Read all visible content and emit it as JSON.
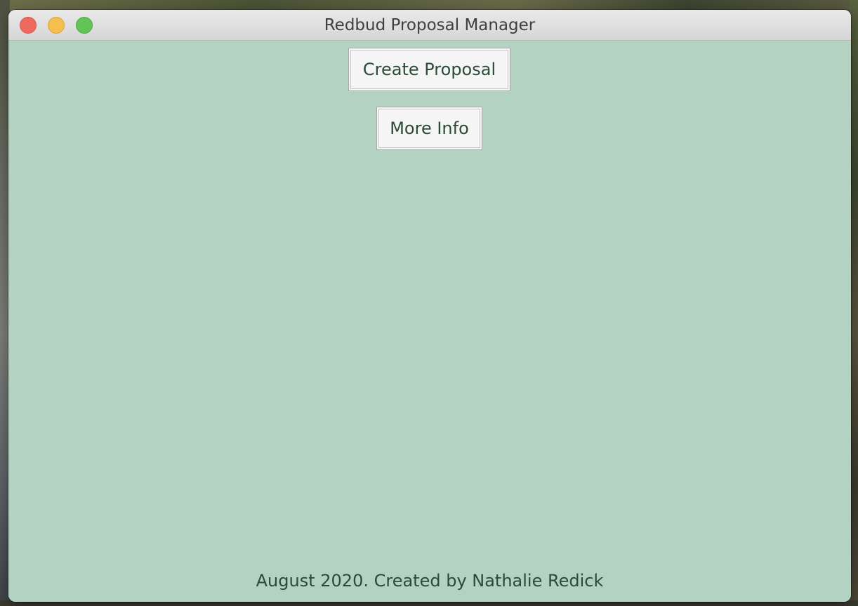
{
  "window": {
    "title": "Redbud Proposal Manager"
  },
  "buttons": {
    "create_proposal": "Create Proposal",
    "more_info": "More Info"
  },
  "footer": {
    "text": "August 2020. Created by Nathalie Redick"
  },
  "colors": {
    "content_background": "#b4d2c1",
    "text": "#2c4a38",
    "button_background": "#f5f5f5",
    "close": "#ee6a5f",
    "minimize": "#f5bf4f",
    "zoom": "#61c454"
  }
}
